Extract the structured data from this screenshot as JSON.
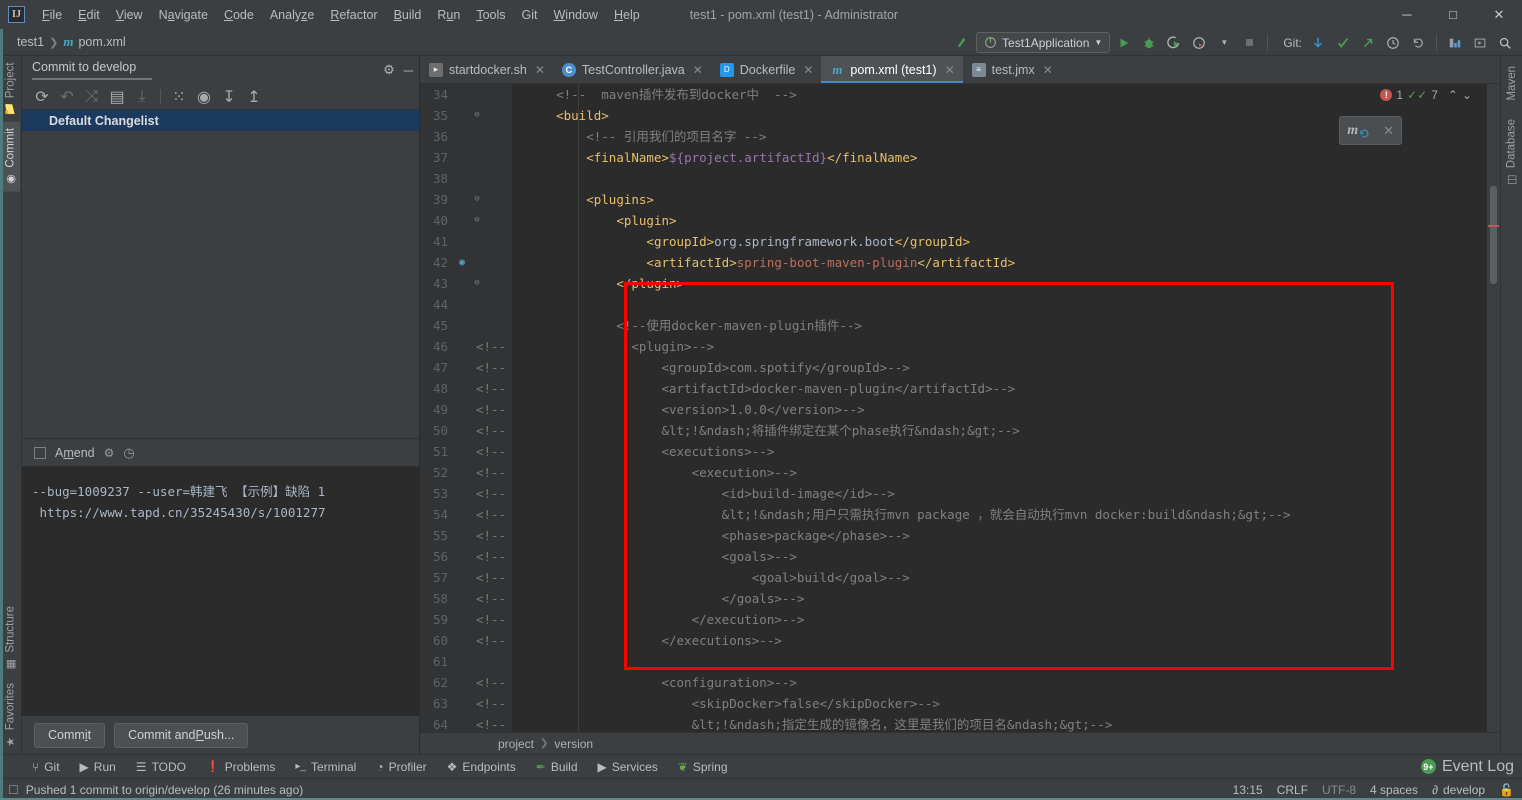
{
  "window": {
    "title": "test1 - pom.xml (test1) - Administrator",
    "logo": "IJ",
    "controls": {
      "minimize": "─",
      "maximize": "□",
      "close": "✕"
    }
  },
  "menu": {
    "items": [
      {
        "label": "File"
      },
      {
        "label": "Edit"
      },
      {
        "label": "View"
      },
      {
        "label": "Navigate"
      },
      {
        "label": "Code"
      },
      {
        "label": "Analyze"
      },
      {
        "label": "Refactor"
      },
      {
        "label": "Build"
      },
      {
        "label": "Run"
      },
      {
        "label": "Tools"
      },
      {
        "label": "Git"
      },
      {
        "label": "Window"
      },
      {
        "label": "Help"
      }
    ]
  },
  "navbar": {
    "crumbs": [
      "test1",
      "pom.xml"
    ],
    "maven_glyph": "m",
    "run_config": "Test1Application",
    "git_label": "Git:",
    "icons": {
      "build": "build-icon",
      "run": "▶",
      "debug": "debug-icon",
      "run_coverage": "coverage-icon",
      "profile": "profiler-icon",
      "stop": "■",
      "update": "update-icon",
      "commit": "commit-icon",
      "push": "push-icon",
      "history": "history-icon",
      "rollback": "rollback-icon",
      "layout": "layout-icon",
      "fullscreen": "fullscreen-icon",
      "search": "⌕"
    }
  },
  "left_tabs": [
    {
      "label": "Project",
      "icon": "folder-icon",
      "active": false
    },
    {
      "label": "Commit",
      "icon": "commit-icon",
      "active": true
    },
    {
      "label": "Structure",
      "icon": "structure-icon",
      "active": false
    },
    {
      "label": "Favorites",
      "icon": "star-icon",
      "active": false
    }
  ],
  "right_tabs": [
    {
      "label": "Maven",
      "icon": "maven-icon"
    },
    {
      "label": "Database",
      "icon": "database-icon"
    }
  ],
  "commit_panel": {
    "title": "Commit to develop",
    "settings_icon": "gear-icon",
    "minimize_icon": "─",
    "toolbar": [
      {
        "name": "refresh-changes",
        "glyph": "⟳",
        "dim": false
      },
      {
        "name": "rollback-changes",
        "glyph": "↶",
        "dim": true
      },
      {
        "name": "show-diff",
        "glyph": "⤨",
        "dim": true
      },
      {
        "name": "edit-source",
        "glyph": "▤",
        "dim": false
      },
      {
        "name": "update-project",
        "glyph": "⤓",
        "dim": true
      },
      {
        "name": "group-by",
        "glyph": "⁙",
        "dim": false
      },
      {
        "name": "view-options",
        "glyph": "◉",
        "dim": false
      },
      {
        "name": "expand-all",
        "glyph": "↧",
        "dim": false
      },
      {
        "name": "collapse-all",
        "glyph": "↥",
        "dim": false
      }
    ],
    "changelist": "Default Changelist",
    "amend_label": "Amend",
    "amend_checked": false,
    "amend_gear": "gear-icon",
    "amend_history": "clock-icon",
    "message_lines": [
      "--bug=1009237 --user=韩建飞 【示例】缺陷 1",
      " https://www.tapd.cn/35245430/s/1001277"
    ],
    "commit_button": "Commit",
    "commit_push_button": "Commit and Push..."
  },
  "editor_tabs": [
    {
      "label": "startdocker.sh",
      "icon": "shell-file-icon",
      "icon_text": "▸",
      "active": false,
      "close": "✕"
    },
    {
      "label": "TestController.java",
      "icon": "java-class-icon",
      "icon_text": "C",
      "active": false,
      "close": "✕"
    },
    {
      "label": "Dockerfile",
      "icon": "dockerfile-icon",
      "icon_text": "D",
      "active": false,
      "close": "✕"
    },
    {
      "label": "pom.xml (test1)",
      "icon": "maven-pom-icon",
      "icon_text": "m",
      "active": true,
      "close": "✕"
    },
    {
      "label": "test.jmx",
      "icon": "jmx-file-icon",
      "icon_text": "≡",
      "active": false,
      "close": "✕"
    }
  ],
  "editor": {
    "first_line": 34,
    "inspection": {
      "error_count": "1",
      "warning_count": "7",
      "up": "⌃",
      "down": "⌄"
    },
    "maven_popup": {
      "glyph": "m",
      "reload": "reload-icon",
      "close": "✕"
    },
    "breadcrumbs": [
      "project",
      "version"
    ],
    "lines": [
      {
        "n": 34,
        "fold": "",
        "comment": "",
        "html": "    <span class='cmt'>&lt;!--  maven插件发布到docker中  --&gt;</span>"
      },
      {
        "n": 35,
        "fold": "⊖",
        "comment": "",
        "html": "    <span class='tag'>&lt;build&gt;</span>"
      },
      {
        "n": 36,
        "fold": "",
        "comment": "",
        "html": "        <span class='cmt'>&lt;!-- 引用我们的项目名字 --&gt;</span>"
      },
      {
        "n": 37,
        "fold": "",
        "comment": "",
        "html": "        <span class='tag'>&lt;finalName&gt;</span><span class='var'>${project.artifactId}</span><span class='tag'>&lt;/finalName&gt;</span>"
      },
      {
        "n": 38,
        "fold": "",
        "comment": "",
        "html": ""
      },
      {
        "n": 39,
        "fold": "⊖",
        "comment": "",
        "html": "        <span class='tag'>&lt;plugins&gt;</span>"
      },
      {
        "n": 40,
        "fold": "⊖",
        "comment": "",
        "html": "            <span class='tag'>&lt;plugin&gt;</span>"
      },
      {
        "n": 41,
        "fold": "",
        "comment": "",
        "html": "                <span class='tag'>&lt;groupId&gt;</span><span class='txt'>org.springframework.boot</span><span class='tag'>&lt;/groupId&gt;</span>"
      },
      {
        "n": 42,
        "fold": "",
        "mark": "maven-add-icon",
        "comment": "",
        "html": "                <span class='tag'>&lt;artifactId&gt;</span><span class='val'>spring-boot-maven-plugin</span><span class='tag'>&lt;/artifactId&gt;</span>"
      },
      {
        "n": 43,
        "fold": "⊖",
        "comment": "",
        "html": "            <span class='tag'>&lt;/plugin&gt;</span>"
      },
      {
        "n": 44,
        "fold": "",
        "comment": "",
        "html": ""
      },
      {
        "n": 45,
        "fold": "",
        "comment": "",
        "html": "            <span class='cmt'>&lt;!--使用docker-maven-plugin插件--&gt;</span>"
      },
      {
        "n": 46,
        "fold": "",
        "comment": "&lt;!--",
        "html": "              <span class='cmt'>&lt;plugin&gt;--&gt;</span>"
      },
      {
        "n": 47,
        "fold": "",
        "comment": "&lt;!--",
        "html": "                  <span class='cmt'>&lt;groupId&gt;com.spotify&lt;/groupId&gt;--&gt;</span>"
      },
      {
        "n": 48,
        "fold": "",
        "comment": "&lt;!--",
        "html": "                  <span class='cmt'>&lt;artifactId&gt;docker-maven-plugin&lt;/artifactId&gt;--&gt;</span>"
      },
      {
        "n": 49,
        "fold": "",
        "comment": "&lt;!--",
        "html": "                  <span class='cmt'>&lt;version&gt;1.0.0&lt;/version&gt;--&gt;</span>"
      },
      {
        "n": 50,
        "fold": "",
        "comment": "&lt;!--",
        "html": "                  <span class='cmt'>&amp;lt;!&amp;ndash;将插件绑定在某个phase执行&amp;ndash;&amp;gt;--&gt;</span>"
      },
      {
        "n": 51,
        "fold": "",
        "comment": "&lt;!--",
        "html": "                  <span class='cmt'>&lt;executions&gt;--&gt;</span>"
      },
      {
        "n": 52,
        "fold": "",
        "comment": "&lt;!--",
        "html": "                      <span class='cmt'>&lt;execution&gt;--&gt;</span>"
      },
      {
        "n": 53,
        "fold": "",
        "comment": "&lt;!--",
        "html": "                          <span class='cmt'>&lt;id&gt;build-image&lt;/id&gt;--&gt;</span>"
      },
      {
        "n": 54,
        "fold": "",
        "comment": "&lt;!--",
        "html": "                          <span class='cmt'>&amp;lt;!&amp;ndash;用户只需执行mvn package ，就会自动执行mvn docker:build&amp;ndash;&amp;gt;--&gt;</span>"
      },
      {
        "n": 55,
        "fold": "",
        "comment": "&lt;!--",
        "html": "                          <span class='cmt'>&lt;phase&gt;package&lt;/phase&gt;--&gt;</span>"
      },
      {
        "n": 56,
        "fold": "",
        "comment": "&lt;!--",
        "html": "                          <span class='cmt'>&lt;goals&gt;--&gt;</span>"
      },
      {
        "n": 57,
        "fold": "",
        "comment": "&lt;!--",
        "html": "                              <span class='cmt'>&lt;goal&gt;build&lt;/goal&gt;--&gt;</span>"
      },
      {
        "n": 58,
        "fold": "",
        "comment": "&lt;!--",
        "html": "                          <span class='cmt'>&lt;/goals&gt;--&gt;</span>"
      },
      {
        "n": 59,
        "fold": "",
        "comment": "&lt;!--",
        "html": "                      <span class='cmt'>&lt;/execution&gt;--&gt;</span>"
      },
      {
        "n": 60,
        "fold": "",
        "comment": "&lt;!--",
        "html": "                  <span class='cmt'>&lt;/executions&gt;--&gt;</span>"
      },
      {
        "n": 61,
        "fold": "",
        "comment": "",
        "html": ""
      },
      {
        "n": 62,
        "fold": "",
        "comment": "&lt;!--",
        "html": "                  <span class='cmt'>&lt;configuration&gt;--&gt;</span>"
      },
      {
        "n": 63,
        "fold": "",
        "comment": "&lt;!--",
        "html": "                      <span class='cmt'>&lt;skipDocker&gt;false&lt;/skipDocker&gt;--&gt;</span>"
      },
      {
        "n": 64,
        "fold": "",
        "comment": "&lt;!--",
        "html": "                      <span class='cmt'>&amp;lt;!&amp;ndash;指定生成的镜像名，这里是我们的项目名&amp;ndash;&amp;gt;--&gt;</span>"
      }
    ]
  },
  "tool_windows": {
    "items": [
      {
        "label": "Git",
        "icon": "git-branch-icon",
        "glyph": "⑂"
      },
      {
        "label": "Run",
        "icon": "run-icon",
        "glyph": "▶"
      },
      {
        "label": "TODO",
        "icon": "todo-icon",
        "glyph": "☰"
      },
      {
        "label": "Problems",
        "icon": "problems-icon",
        "glyph": "❗"
      },
      {
        "label": "Terminal",
        "icon": "terminal-icon",
        "glyph": "▸_"
      },
      {
        "label": "Profiler",
        "icon": "profiler-icon",
        "glyph": "◔"
      },
      {
        "label": "Endpoints",
        "icon": "endpoints-icon",
        "glyph": "❖"
      },
      {
        "label": "Build",
        "icon": "build-icon",
        "glyph": "✒"
      },
      {
        "label": "Services",
        "icon": "services-icon",
        "glyph": "▶"
      },
      {
        "label": "Spring",
        "icon": "spring-icon",
        "glyph": "❦"
      }
    ],
    "event_log": {
      "label": "Event Log",
      "badge": "9+"
    }
  },
  "statusbar": {
    "message": "Pushed 1 commit to origin/develop (26 minutes ago)",
    "message_icon": "notification-icon",
    "position": "13:15",
    "line_separator": "CRLF",
    "encoding": "UTF-8",
    "indent": "4 spaces",
    "branch": "develop",
    "branch_icon": "git-branch-icon",
    "lock_icon": "lock-icon"
  },
  "colors": {
    "accent": "#4a88c7",
    "annotation_red": "#ff0000",
    "error": "#c75450",
    "warning": "#5a9e49",
    "selection": "#1c3a5e"
  }
}
